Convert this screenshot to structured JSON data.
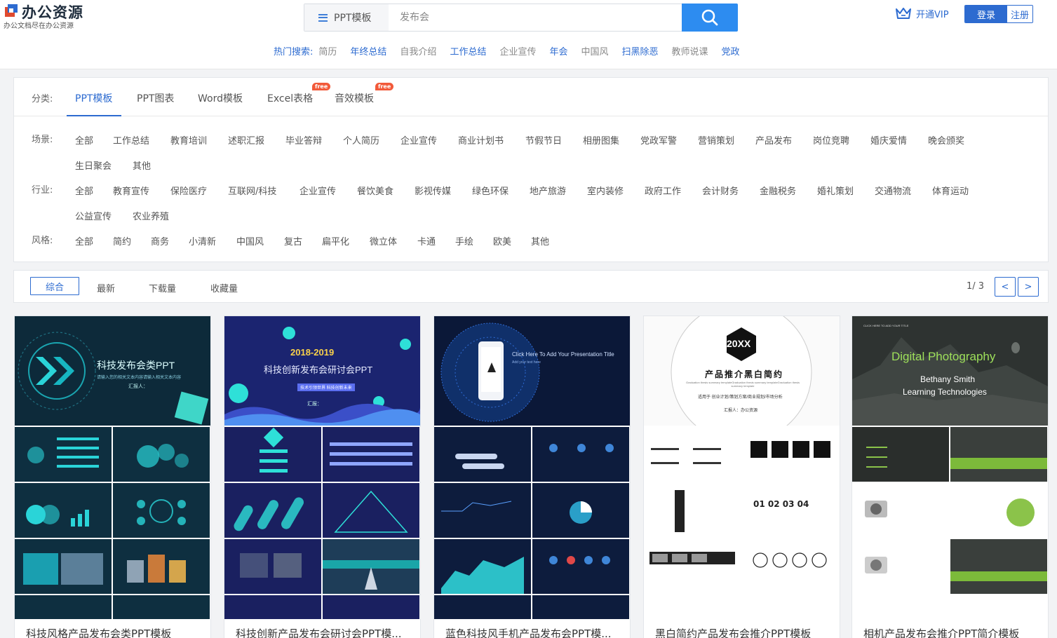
{
  "header": {
    "logo": {
      "name": "办公资源",
      "slogan": "办公文档尽在办公资源"
    },
    "search": {
      "category": "PPT模板",
      "placeholder": "发布会"
    },
    "hot": {
      "label": "热门搜索:",
      "terms": [
        {
          "text": "简历",
          "style": "muted"
        },
        {
          "text": "年终总结",
          "style": "accent"
        },
        {
          "text": "自我介绍",
          "style": "muted"
        },
        {
          "text": "工作总结",
          "style": "accent"
        },
        {
          "text": "企业宣传",
          "style": "muted"
        },
        {
          "text": "年会",
          "style": "accent"
        },
        {
          "text": "中国风",
          "style": "muted"
        },
        {
          "text": "扫黑除恶",
          "style": "accent"
        },
        {
          "text": "教师说课",
          "style": "muted"
        },
        {
          "text": "党政",
          "style": "accent"
        }
      ]
    },
    "vip": "开通VIP",
    "login": "登录",
    "register": "注册"
  },
  "filter": {
    "category_label": "分类:",
    "categories": [
      {
        "label": "PPT模板",
        "active": true,
        "free": false
      },
      {
        "label": "PPT图表",
        "active": false,
        "free": false
      },
      {
        "label": "Word模板",
        "active": false,
        "free": false
      },
      {
        "label": "Excel表格",
        "active": false,
        "free": true
      },
      {
        "label": "音效模板",
        "active": false,
        "free": true
      }
    ],
    "free_badge": "free",
    "scene": {
      "label": "场景:",
      "options": [
        "全部",
        "工作总结",
        "教育培训",
        "述职汇报",
        "毕业答辩",
        "个人简历",
        "企业宣传",
        "商业计划书",
        "节假节日",
        "相册图集",
        "党政军警",
        "营销策划",
        "产品发布",
        "岗位竞聘",
        "婚庆爱情",
        "晚会颁奖",
        "生日聚会",
        "其他"
      ]
    },
    "industry": {
      "label": "行业:",
      "options": [
        "全部",
        "教育宣传",
        "保险医疗",
        "互联网/科技",
        "企业宣传",
        "餐饮美食",
        "影视传媒",
        "绿色环保",
        "地产旅游",
        "室内装修",
        "政府工作",
        "会计财务",
        "金融税务",
        "婚礼策划",
        "交通物流",
        "体育运动",
        "公益宣传",
        "农业养殖"
      ]
    },
    "style": {
      "label": "风格:",
      "options": [
        "全部",
        "简约",
        "商务",
        "小清新",
        "中国风",
        "复古",
        "扁平化",
        "微立体",
        "卡通",
        "手绘",
        "欧美",
        "其他"
      ]
    }
  },
  "sortbar": {
    "options": [
      "综合",
      "最新",
      "下载量",
      "收藏量"
    ],
    "active": "综合",
    "page": "1/ 3",
    "prev": "<",
    "next": ">"
  },
  "cards": [
    {
      "title": "科技风格产品发布会类PPT模板",
      "cover_title": "科技发布会类PPT",
      "cover_sub": "请输入您的相关文本内容请输入相关文本内容",
      "cover_reporter": "汇报人：",
      "theme": "teal"
    },
    {
      "title": "科技创新产品发布会研讨会PPT模...",
      "cover_year": "2018-2019",
      "cover_title": "科技创新发布会研讨会PPT",
      "cover_tag": "技术引领世界 科技创新未来",
      "cover_reporter": "汇报：",
      "theme": "navy"
    },
    {
      "title": "蓝色科技风手机产品发布会PPT模...",
      "cover_title": "Click Here To Add Your Presentation Title",
      "cover_sub": "Add your text here",
      "theme": "blue"
    },
    {
      "title": "黑白简约产品发布会推介PPT模板",
      "cover_year": "20XX",
      "cover_title": "产品推介黑白简约",
      "cover_sub": "Graduation thesis summary templateGraduation thesis summary templateGraduation thesis summary template",
      "cover_use": "适用于 创业计划/策划方案/商业规划/市场分析",
      "cover_reporter": "汇报人：办公资源",
      "theme": "mono"
    },
    {
      "title": "相机产品发布会推介PPT简介模板",
      "cover_title": "Digital Photography",
      "cover_name": "Bethany Smith",
      "cover_sub": "Learning Technologies",
      "cover_tag": "CLICK HERE TO ADD YOUR TITLE",
      "theme": "photo"
    }
  ],
  "colors": {
    "accent": "#2d6bd0",
    "search_button": "#2d8cf0",
    "free_badge": "#f25a3a"
  }
}
